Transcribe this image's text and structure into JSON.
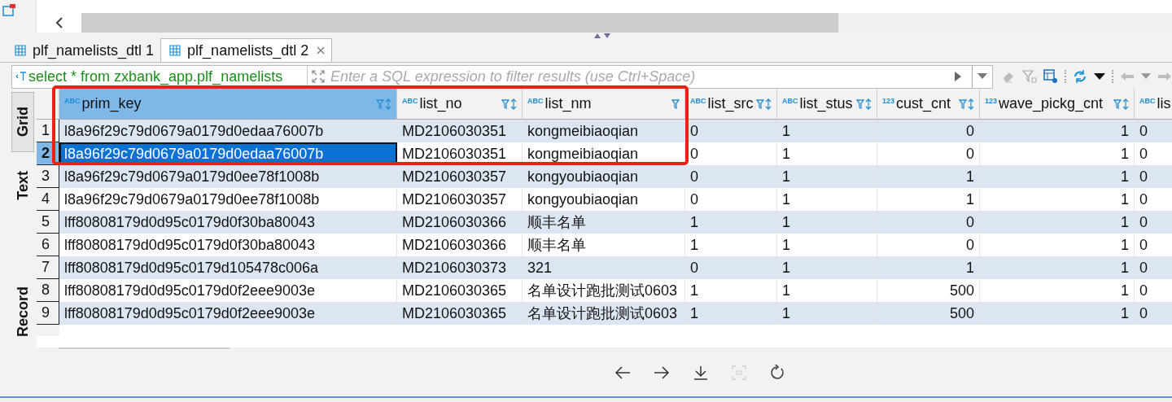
{
  "tabs": [
    {
      "label": "plf_namelists_dtl 1",
      "selected": false,
      "closable": false
    },
    {
      "label": "plf_namelists_dtl 2",
      "selected": true,
      "closable": true
    }
  ],
  "filter": {
    "query": "select * from zxbank_app.plf_namelists",
    "placeholder": "Enter a SQL expression to filter results (use Ctrl+Space)"
  },
  "view_tabs": [
    {
      "label": "Grid",
      "selected": true
    },
    {
      "label": "Text",
      "selected": false
    },
    {
      "label": "Record",
      "selected": false
    }
  ],
  "table": {
    "columns": [
      {
        "name": "prim_key",
        "type_label": "ABC",
        "kind": "text",
        "sortable": true,
        "selected": true
      },
      {
        "name": "list_no",
        "type_label": "ABC",
        "kind": "text",
        "sortable": true,
        "selected": false
      },
      {
        "name": "list_nm",
        "type_label": "ABC",
        "kind": "text",
        "sortable": false,
        "selected": false
      },
      {
        "name": "list_src",
        "type_label": "ABC",
        "kind": "text",
        "sortable": true,
        "selected": false
      },
      {
        "name": "list_stus",
        "type_label": "ABC",
        "kind": "text",
        "sortable": true,
        "selected": false
      },
      {
        "name": "cust_cnt",
        "type_label": "123",
        "kind": "number",
        "sortable": true,
        "selected": false
      },
      {
        "name": "wave_pickg_cnt",
        "type_label": "123",
        "kind": "number",
        "sortable": true,
        "selected": false
      },
      {
        "name": "lis",
        "type_label": "ABC",
        "kind": "text",
        "selected": false
      }
    ],
    "rows": [
      {
        "num": "1",
        "selected": false,
        "cells": [
          "l8a96f29c79d0679a0179d0edaa76007b",
          "MD2106030351",
          "kongmeibiaoqian",
          "0",
          "1",
          "0",
          "1",
          "0"
        ]
      },
      {
        "num": "2",
        "selected": true,
        "cells": [
          "l8a96f29c79d0679a0179d0edaa76007b",
          "MD2106030351",
          "kongmeibiaoqian",
          "0",
          "1",
          "0",
          "1",
          "0"
        ]
      },
      {
        "num": "3",
        "selected": false,
        "cells": [
          "l8a96f29c79d0679a0179d0ee78f1008b",
          "MD2106030357",
          "kongyoubiaoqian",
          "0",
          "1",
          "1",
          "1",
          "0"
        ]
      },
      {
        "num": "4",
        "selected": false,
        "cells": [
          "l8a96f29c79d0679a0179d0ee78f1008b",
          "MD2106030357",
          "kongyoubiaoqian",
          "0",
          "1",
          "1",
          "1",
          "0"
        ]
      },
      {
        "num": "5",
        "selected": false,
        "cells": [
          "lff80808179d0d95c0179d0f30ba80043",
          "MD2106030366",
          "顺丰名单",
          "1",
          "1",
          "0",
          "1",
          "0"
        ]
      },
      {
        "num": "6",
        "selected": false,
        "cells": [
          "lff80808179d0d95c0179d0f30ba80043",
          "MD2106030366",
          "顺丰名单",
          "1",
          "1",
          "0",
          "1",
          "0"
        ]
      },
      {
        "num": "7",
        "selected": false,
        "cells": [
          "lff80808179d0d95c0179d105478c006a",
          "MD2106030373",
          "321",
          "0",
          "1",
          "1",
          "1",
          "0"
        ]
      },
      {
        "num": "8",
        "selected": false,
        "cells": [
          "lff80808179d0d95c0179d0f2eee9003e",
          "MD2106030365",
          "名单设计跑批测试0603",
          "1",
          "1",
          "500",
          "1",
          "0"
        ]
      },
      {
        "num": "9",
        "selected": false,
        "cells": [
          "lff80808179d0d95c0179d0f2eee9003e",
          "MD2106030365",
          "名单设计跑批测试0603",
          "1",
          "1",
          "500",
          "1",
          "0"
        ]
      }
    ]
  }
}
